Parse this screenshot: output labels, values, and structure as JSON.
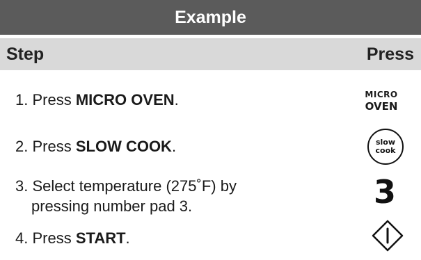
{
  "title": "Example",
  "header": {
    "step": "Step",
    "press": "Press"
  },
  "steps": [
    {
      "number": "1.",
      "prefix": "Press ",
      "bold": "MICRO OVEN",
      "suffix": "."
    },
    {
      "number": "2.",
      "prefix": "Press ",
      "bold": "SLOW COOK",
      "suffix": "."
    },
    {
      "number": "3.",
      "line1": "Select temperature (275˚F) by",
      "line2": "pressing number pad 3."
    },
    {
      "number": "4.",
      "prefix": "Press ",
      "bold": "START",
      "suffix": "."
    }
  ],
  "press_icons": {
    "micro_oven": {
      "line1": "MICRO",
      "line2": "OVEN"
    },
    "slow_cook": {
      "line1": "slow",
      "line2": "cook"
    },
    "number_key": "3",
    "start_icon": "start-diamond-icon"
  },
  "colors": {
    "title_bg": "#5b5b5b",
    "header_bg": "#d9d9d9",
    "text": "#1a1a1a"
  }
}
